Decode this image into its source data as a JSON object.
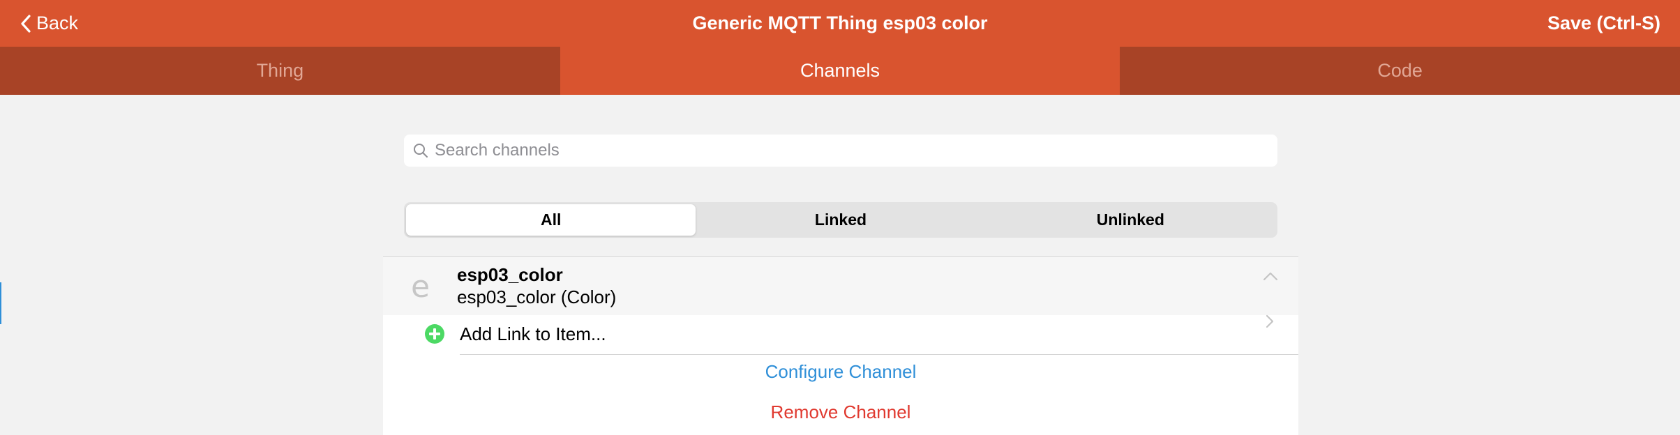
{
  "navbar": {
    "back_label": "Back",
    "title": "Generic MQTT Thing esp03 color",
    "save_label": "Save (Ctrl-S)",
    "color": "#d9542f"
  },
  "tabs": [
    {
      "label": "Thing",
      "active": false
    },
    {
      "label": "Channels",
      "active": true
    },
    {
      "label": "Code",
      "active": false
    }
  ],
  "search": {
    "placeholder": "Search channels",
    "value": "",
    "icon": "search-icon"
  },
  "filter": {
    "options": [
      "All",
      "Linked",
      "Unlinked"
    ],
    "selected": "All"
  },
  "channel": {
    "icon_glyph": "e",
    "name": "esp03_color",
    "subtitle": "esp03_color (Color)",
    "expanded": true,
    "add_link_label": "Add Link to Item...",
    "configure_label": "Configure Channel",
    "remove_label": "Remove Channel",
    "link_color": "#2f8fd8",
    "danger_color": "#e0392f",
    "add_color": "#4cd964"
  }
}
